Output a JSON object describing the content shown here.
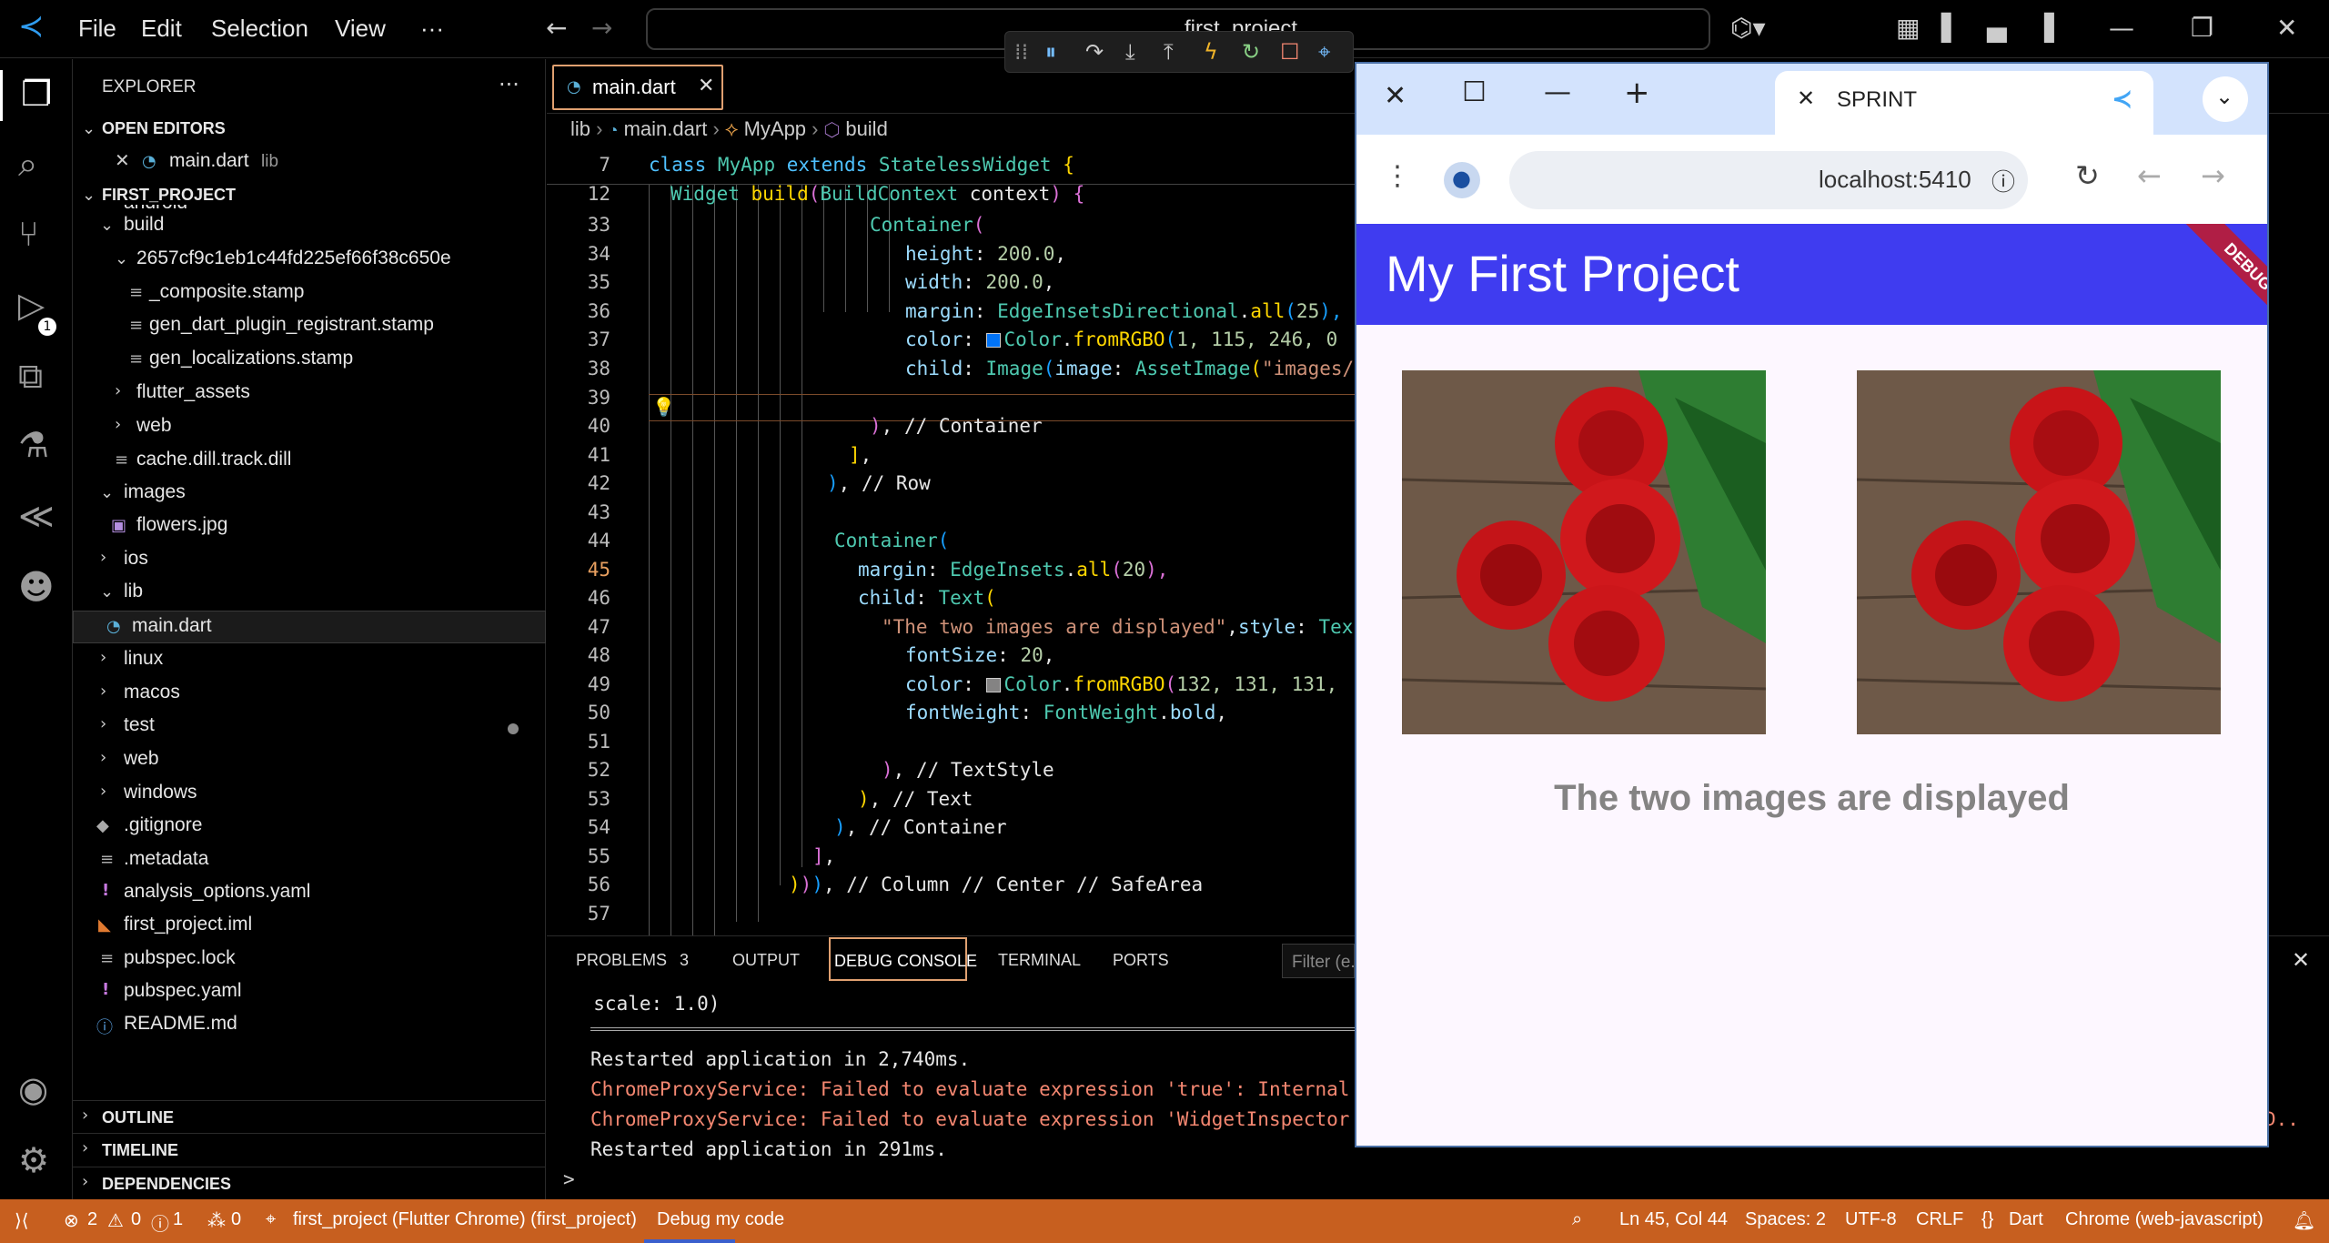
{
  "titlebar": {
    "menu": [
      "File",
      "Edit",
      "Selection",
      "View",
      "···"
    ],
    "command_center": "first_project"
  },
  "explorer": {
    "title": "EXPLORER",
    "open_editors_label": "OPEN EDITORS",
    "open_editor": {
      "name": "main.dart",
      "path": "lib"
    },
    "project_label": "FIRST_PROJECT",
    "tree": {
      "android": "android",
      "build": "build",
      "hash": "2657cf9c1eb1c44fd225ef66f38c650e",
      "composite": "_composite.stamp",
      "gen_plugin": "gen_dart_plugin_registrant.stamp",
      "gen_loc": "gen_localizations.stamp",
      "flutter_assets": "flutter_assets",
      "web_build": "web",
      "cache": "cache.dill.track.dill",
      "images": "images",
      "flowers": "flowers.jpg",
      "ios": "ios",
      "lib": "lib",
      "main": "main.dart",
      "linux": "linux",
      "macos": "macos",
      "test": "test",
      "web": "web",
      "windows": "windows",
      "gitignore": ".gitignore",
      "metadata": ".metadata",
      "analysis": "analysis_options.yaml",
      "iml": "first_project.iml",
      "lock": "pubspec.lock",
      "pubspec": "pubspec.yaml",
      "readme": "README.md"
    },
    "outline": "OUTLINE",
    "timeline": "TIMELINE",
    "dependencies": "DEPENDENCIES"
  },
  "activity": {
    "debug_badge": "1"
  },
  "editor": {
    "tab": "main.dart",
    "breadcrumb": {
      "lib": "lib",
      "file": "main.dart",
      "cls": "MyApp",
      "method": "build"
    },
    "lines": {
      "n7": "7",
      "n12": "12",
      "n33": "33",
      "n34": "34",
      "n35": "35",
      "n36": "36",
      "n37": "37",
      "n38": "38",
      "n39": "39",
      "n40": "40",
      "n41": "41",
      "n42": "42",
      "n43": "43",
      "n44": "44",
      "n45": "45",
      "n46": "46",
      "n47": "47",
      "n48": "48",
      "n49": "49",
      "n50": "50",
      "n51": "51",
      "n52": "52",
      "n53": "53",
      "n54": "54",
      "n55": "55",
      "n56": "56",
      "n57": "57"
    },
    "code": {
      "l7a": "class",
      "l7b": "MyApp",
      "l7c": "extends",
      "l7d": "StatelessWidget",
      "l7e": "{",
      "l12a": "Widget",
      "l12b": "build",
      "l12c": "(",
      "l12d": "BuildContext",
      "l12e": " context",
      "l12f": ")",
      "l12g": " {",
      "l33a": "Container",
      "l33b": "(",
      "l34a": "height",
      "l34b": ": ",
      "l34c": "200.0",
      "l34d": ",",
      "l35a": "width",
      "l35b": ": ",
      "l35c": "200.0",
      "l35d": ",",
      "l36a": "margin",
      "l36b": ": ",
      "l36c": "EdgeInsetsDirectional",
      "l36d": ".",
      "l36e": "all",
      "l36f": "(",
      "l36g": "25",
      "l36h": "),",
      "l37a": "color",
      "l37b": ": ",
      "l37c": "Color",
      "l37d": ".",
      "l37e": "fromRGBO",
      "l37f": "(",
      "l37g": "1, 115, 246, 0",
      "l38a": "child",
      "l38b": ": ",
      "l38c": "Image",
      "l38d": "(",
      "l38e": "image",
      "l38f": ": ",
      "l38g": "AssetImage",
      "l38h": "(",
      "l38i": "\"images/",
      "l40a": ")",
      "l40b": ", // Container",
      "l41a": "]",
      "l41b": ",",
      "l42a": ")",
      "l42b": ", // Row",
      "l44a": "Container",
      "l44b": "(",
      "l45a": "margin",
      "l45b": ": ",
      "l45c": "EdgeInsets",
      "l45d": ".",
      "l45e": "all",
      "l45f": "(",
      "l45g": "20",
      "l45h": "),",
      "l46a": "child",
      "l46b": ": ",
      "l46c": "Text",
      "l46d": "(",
      "l47a": "\"The two images are displayed\"",
      "l47b": ",",
      "l47c": "style",
      "l47d": ": ",
      "l47e": "Tex",
      "l48a": "fontSize",
      "l48b": ": ",
      "l48c": "20",
      "l48d": ",",
      "l49a": "color",
      "l49b": ": ",
      "l49c": "Color",
      "l49d": ".",
      "l49e": "fromRGBO",
      "l49f": "(",
      "l49g": "132, 131, 131,",
      "l50a": "fontWeight",
      "l50b": ": ",
      "l50c": "FontWeight",
      "l50d": ".",
      "l50e": "bold",
      "l50f": ",",
      "l52a": ")",
      "l52b": ", // TextStyle",
      "l53a": ")",
      "l53b": ", // Text",
      "l54a": ")",
      "l54b": ", // Container",
      "l55a": "]",
      "l55b": ",",
      "l56a": ")",
      "l56b": ")",
      "l56c": ")",
      "l56d": ", // Column // Center // SafeArea"
    }
  },
  "panel": {
    "tabs": {
      "problems": "PROBLEMS",
      "problems_count": "3",
      "output": "OUTPUT",
      "debug": "DEBUG CONSOLE",
      "terminal": "TERMINAL",
      "ports": "PORTS"
    },
    "filter_placeholder": "Filter (e.",
    "lines": {
      "l1": "  scale: 1.0)",
      "l2": "Restarted application in 2,740ms.",
      "l3": "ChromeProxyService: Failed to evaluate expression 'true': Internal",
      "l4": "ChromeProxyService: Failed to evaluate expression 'WidgetInspector",
      "l4_tail": "D..",
      "l5": "Restarted application in 291ms."
    },
    "prompt": ">"
  },
  "browser": {
    "tab_title": "SPRINT",
    "url": "localhost:5410",
    "app_title": "My First Project",
    "debug_banner": "DEBUG",
    "body_text": "The two images are displayed",
    "colors": {
      "appbar": "#3f3cf0",
      "text": "#848383",
      "banner": "#b01e45"
    }
  },
  "statusbar": {
    "errors": "2",
    "warnings": "0",
    "info": "1",
    "ports": "0",
    "session": "first_project (Flutter Chrome) (first_project)",
    "debug_code": "Debug my code",
    "position": "Ln 45, Col 44",
    "spaces": "Spaces: 2",
    "encoding": "UTF-8",
    "eol": "CRLF",
    "language": "Dart",
    "device": "Chrome (web-javascript)"
  }
}
